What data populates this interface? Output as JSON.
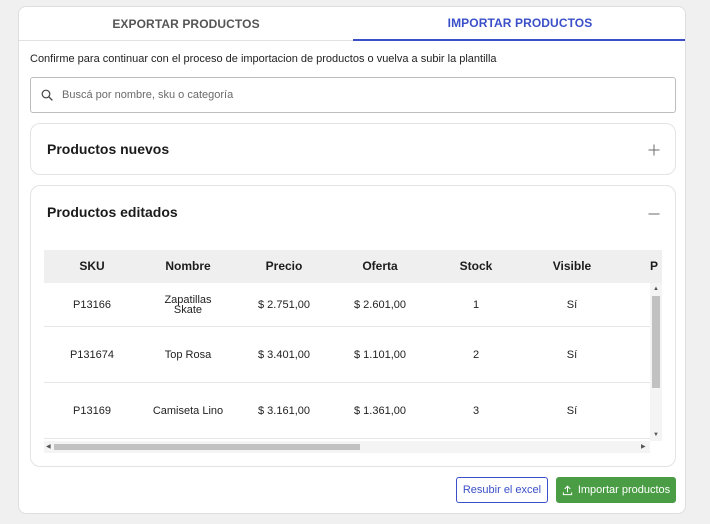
{
  "tabs": [
    {
      "label": "EXPORTAR PRODUCTOS",
      "active": false
    },
    {
      "label": "IMPORTAR PRODUCTOS",
      "active": true
    }
  ],
  "intro_text": "Confirme para continuar con el proceso de importacion de productos o vuelva a subir la plantilla",
  "search": {
    "placeholder": "Buscá por nombre, sku o categoría",
    "value": ""
  },
  "sections": {
    "new": {
      "title": "Productos nuevos",
      "expanded": false,
      "toggle_icon": "plus-icon"
    },
    "edited": {
      "title": "Productos editados",
      "expanded": true,
      "toggle_icon": "minus-icon"
    }
  },
  "table": {
    "columns": [
      "SKU",
      "Nombre",
      "Precio",
      "Oferta",
      "Stock",
      "Visible",
      "P"
    ],
    "rows": [
      [
        "P13166",
        "Zapatillas Skate",
        "$ 2.751,00",
        "$ 2.601,00",
        "1",
        "Sí"
      ],
      [
        "P131674",
        "Top Rosa",
        "$ 3.401,00",
        "$ 1.101,00",
        "2",
        "Sí"
      ],
      [
        "P13169",
        "Camiseta Lino",
        "$ 3.161,00",
        "$ 1.361,00",
        "3",
        "Sí"
      ]
    ]
  },
  "buttons": {
    "reupload": "Resubir el excel",
    "import": "Importar productos"
  },
  "colors": {
    "accent": "#3a4fc8",
    "success": "#4a9d45",
    "header_bg": "#efefef"
  }
}
